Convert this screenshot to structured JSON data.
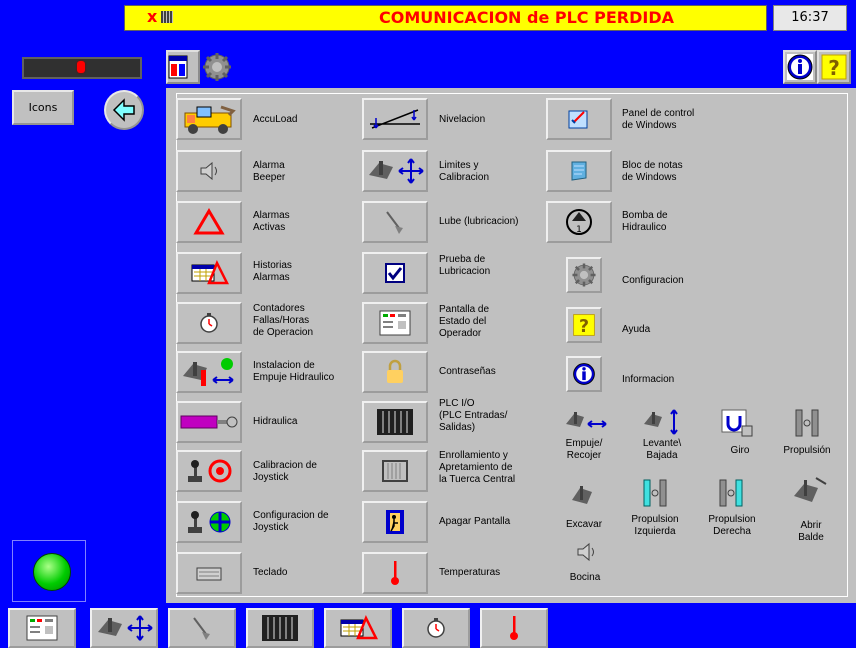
{
  "header": {
    "title": "COMUNICACION de PLC PERDIDA",
    "clock": "16:37",
    "alarm_x": "x"
  },
  "left": {
    "icons_label": "Icons"
  },
  "buttons": {
    "accuload": "AccuLoad",
    "alarma_beeper": "Alarma\nBeeper",
    "alarmas_activas": "Alarmas\nActivas",
    "historias_alarmas": "Historias\nAlarmas",
    "contadores": "Contadores\nFallas/Horas\nde Operacion",
    "instalacion": "Instalacion de\nEmpuje Hidraulico",
    "hidraulica": "Hidraulica",
    "calibracion_joystick": "Calibracion de\nJoystick",
    "configuracion_joystick": "Configuracion de\nJoystick",
    "teclado": "Teclado",
    "nivelacion": "Nivelacion",
    "limites": "Limites y\nCalibracion",
    "lube": "Lube (lubricacion)",
    "prueba_lubricacion": "Prueba de\nLubricacion",
    "pantalla_estado": "Pantalla de\nEstado del\nOperador",
    "contrasenas": "Contraseñas",
    "plc_io": "PLC I/O\n(PLC Entradas/\nSalidas)",
    "enrollamiento": "Enrollamiento y\nApretamiento de\nla Tuerca Central",
    "apagar_pantalla": "Apagar Pantalla",
    "temperaturas": "Temperaturas",
    "panel_control": "Panel de control\nde Windows",
    "bloc_notas": "Bloc de notas\nde Windows",
    "bomba": "Bomba de\nHidraulico",
    "configuracion": "Configuracion",
    "ayuda": "Ayuda",
    "informacion": "Informacion"
  },
  "controls": {
    "empuje": "Empuje/\nRecojer",
    "levante": "Levante\\\nBajada",
    "giro": "Giro",
    "propulsion": "Propulsión",
    "excavar": "Excavar",
    "prop_izq": "Propulsion\nIzquierda",
    "prop_der": "Propulsion\nDerecha",
    "abrir_balde": "Abrir\nBalde",
    "bocina": "Bocina"
  },
  "colors": {
    "background": "#0000ff",
    "panel": "#c0c0c0",
    "title_bg": "#ffff00",
    "title_text": "#ff0000",
    "led_green": "#00cc00",
    "info_blue": "#0000cc"
  }
}
